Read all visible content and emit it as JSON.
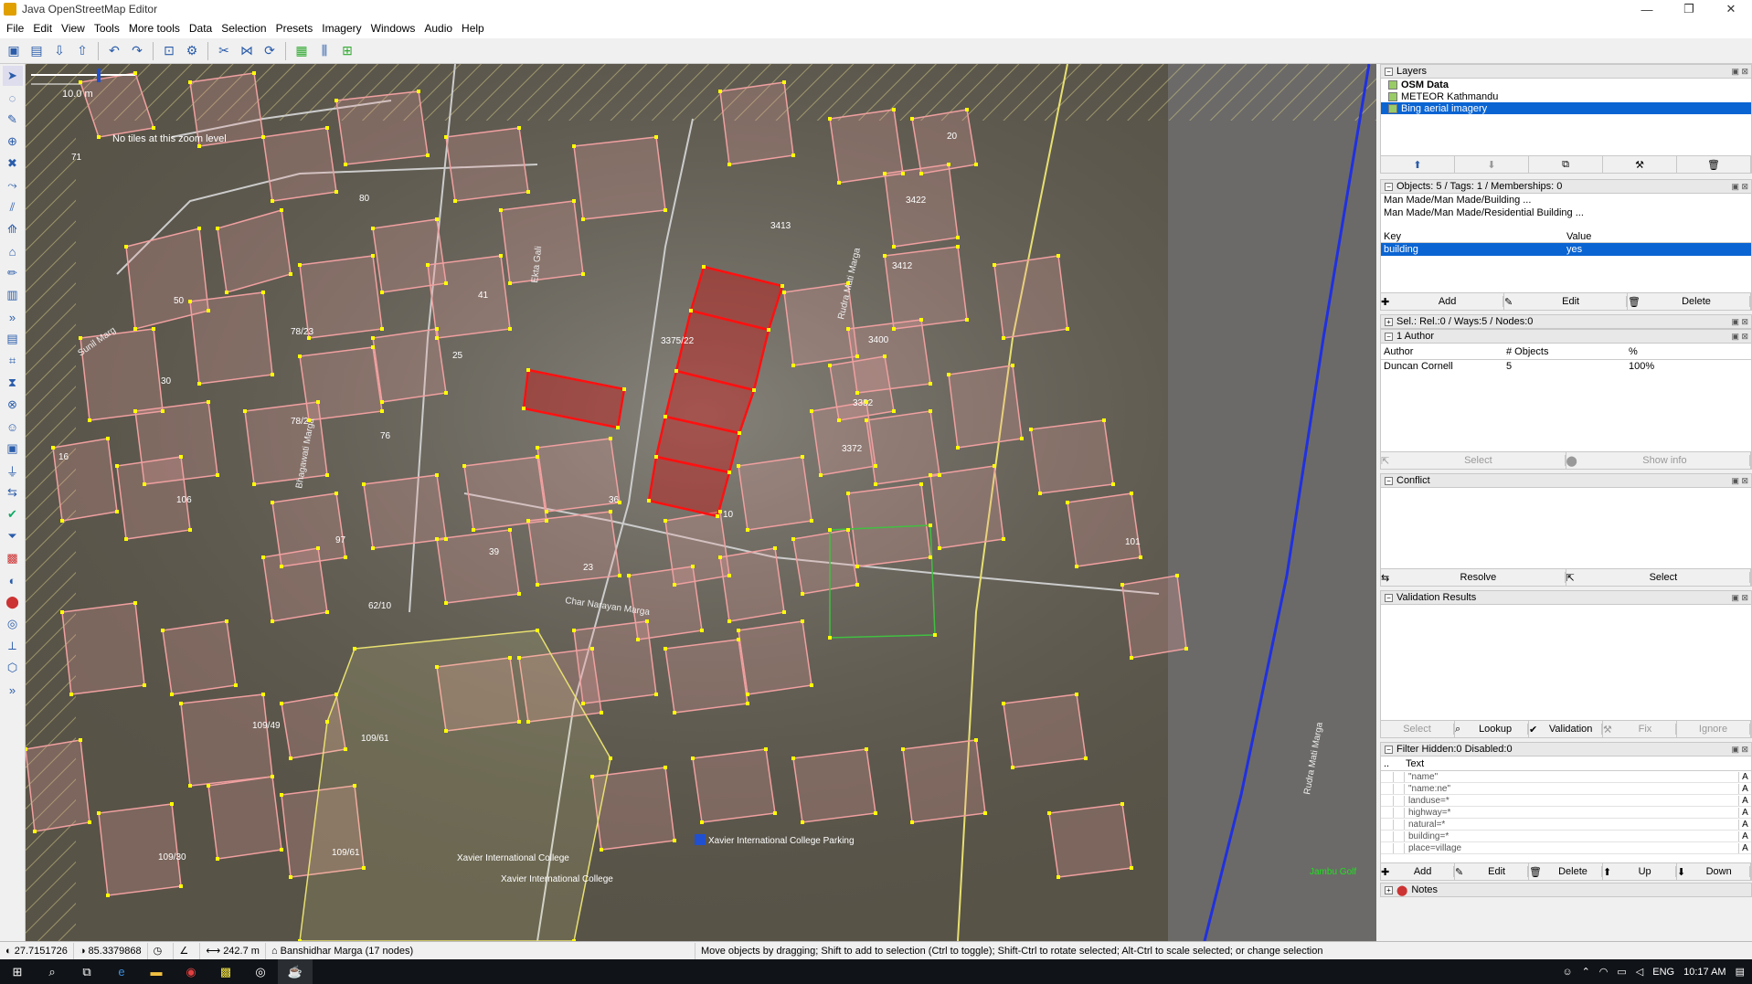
{
  "window": {
    "title": "Java OpenStreetMap Editor",
    "minimize": "—",
    "maximize": "❐",
    "close": "✕"
  },
  "menu": [
    "File",
    "Edit",
    "View",
    "Tools",
    "More tools",
    "Data",
    "Selection",
    "Presets",
    "Imagery",
    "Windows",
    "Audio",
    "Help"
  ],
  "map": {
    "scale_label": "10.0 m",
    "no_tiles": "No tiles at this zoom level",
    "road_labels": [
      "Rudra Mati Marga",
      "Bhagawati Marga",
      "Char Narayan Marga",
      "Sunil Marg",
      "Ekta Gali",
      "Rudra Mati Marga"
    ],
    "house_numbers": [
      "71",
      "80",
      "3413",
      "3422",
      "3412",
      "20",
      "3400",
      "3382",
      "3372",
      "3375/22",
      "41",
      "50",
      "78/23",
      "25",
      "30",
      "76",
      "78/2",
      "16",
      "106",
      "36",
      "10",
      "97",
      "39",
      "23",
      "62/10",
      "101",
      "109/49",
      "109/61",
      "109/30",
      "109/61"
    ],
    "pois": [
      "Xavier International College",
      "Xavier International College",
      "Xavier International College Parking",
      "Jambu Golf"
    ]
  },
  "layers_panel": {
    "title": "Layers",
    "items": [
      {
        "label": "OSM Data",
        "selected": false
      },
      {
        "label": "METEOR Kathmandu",
        "selected": false
      },
      {
        "label": "Bing aerial imagery",
        "selected": true
      }
    ]
  },
  "tags_panel": {
    "title": "Objects: 5 / Tags: 1 / Memberships: 0",
    "presets": [
      "Man Made/Man Made/Building ...",
      "Man Made/Man Made/Residential Building ..."
    ],
    "col_key": "Key",
    "col_value": "Value",
    "rows": [
      {
        "key": "building",
        "value": "yes"
      }
    ],
    "buttons": [
      "Add",
      "Edit",
      "Delete"
    ]
  },
  "selection_panel": {
    "title": "Sel.: Rel.:0 / Ways:5 / Nodes:0"
  },
  "authors_panel": {
    "title": "1 Author",
    "col_author": "Author",
    "col_objects": "# Objects",
    "col_pct": "%",
    "rows": [
      {
        "author": "Duncan Cornell",
        "objects": "5",
        "pct": "100%"
      }
    ],
    "buttons": [
      "Select",
      "Show info"
    ]
  },
  "conflict_panel": {
    "title": "Conflict",
    "buttons": [
      "Resolve",
      "Select"
    ]
  },
  "validation_panel": {
    "title": "Validation Results",
    "buttons": [
      "Select",
      "Lookup",
      "Validation",
      "Fix",
      "Ignore"
    ]
  },
  "filter_panel": {
    "title": "Filter Hidden:0 Disabled:0",
    "col_text": "Text",
    "rows": [
      "\"name\"",
      "\"name:ne\"",
      "landuse=*",
      "highway=*",
      "natural=*",
      "building=*",
      "place=village"
    ],
    "buttons": [
      "Add",
      "Edit",
      "Delete",
      "Up",
      "Down"
    ]
  },
  "notes_panel": {
    "title": "Notes"
  },
  "status": {
    "lat": "27.7151726",
    "lon": "85.3379868",
    "distance": "242.7 m",
    "way": "Banshidhar Marga (17 nodes)",
    "help": "Move objects by dragging; Shift to add to selection (Ctrl to toggle); Shift-Ctrl to rotate selected; Alt-Ctrl to scale selected; or change selection"
  },
  "taskbar": {
    "lang": "ENG",
    "time": "10:17 AM"
  },
  "colors": {
    "selection": "#0a64d2",
    "building_outline": "#f0a0a0",
    "selected_building": "#e00000",
    "node": "#ffff00"
  }
}
